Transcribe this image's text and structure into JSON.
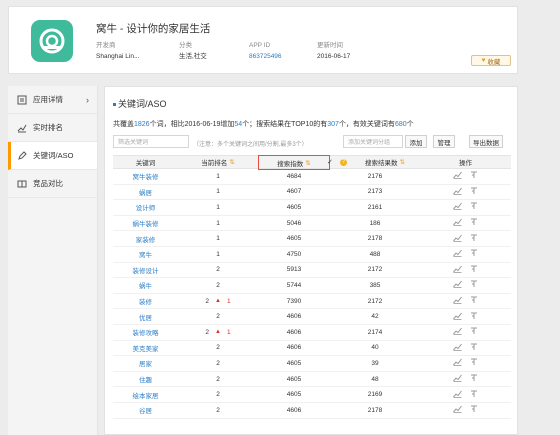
{
  "app": {
    "name": "窝牛 - 设计你的家居生活",
    "meta": [
      {
        "label": "开发商",
        "value": "Shanghai Lin..."
      },
      {
        "label": "分类",
        "value": "生活,社交"
      },
      {
        "label": "APP ID",
        "value": "863725496"
      },
      {
        "label": "更新时间",
        "value": "2016-06-17"
      }
    ],
    "favorite_label": "收藏"
  },
  "sidebar": {
    "items": [
      {
        "label": "应用详情",
        "icon": "app-detail-icon"
      },
      {
        "label": "实时排名",
        "icon": "ranking-chart-icon"
      },
      {
        "label": "关键词/ASO",
        "icon": "pen-icon"
      },
      {
        "label": "竞品对比",
        "icon": "compare-icon"
      }
    ]
  },
  "main": {
    "title": "关键词/ASO",
    "summary": {
      "p1": "共覆盖",
      "total": "1826",
      "p2": "个词，相比2016-06-19增加",
      "added": "54",
      "p3": "个；搜索结果在TOP10的有",
      "top10": "307",
      "p4": "个，有效关键词有",
      "valid": "680",
      "p5": "个"
    },
    "filter_placeholder": "筛选关键词",
    "hint": "（注意：多个关键词之间用/分割,最多3个）",
    "add_placeholder": "添加关键词分组",
    "add_label": "添加",
    "manage_label": "管理",
    "export_label": "导出数据"
  },
  "table": {
    "headers": [
      "关键词",
      "当前排名",
      "搜索指数",
      "搜索结果数",
      "操作"
    ],
    "rows": [
      {
        "keyword": "窝牛装修",
        "rank": "1",
        "change": "",
        "index": "4684",
        "results": "2176"
      },
      {
        "keyword": "蜗居",
        "rank": "1",
        "change": "",
        "index": "4607",
        "results": "2173"
      },
      {
        "keyword": "设计师",
        "rank": "1",
        "change": "",
        "index": "4605",
        "results": "2161"
      },
      {
        "keyword": "蜗牛装修",
        "rank": "1",
        "change": "",
        "index": "5046",
        "results": "186"
      },
      {
        "keyword": "家装修",
        "rank": "1",
        "change": "",
        "index": "4605",
        "results": "2178"
      },
      {
        "keyword": "窝牛",
        "rank": "1",
        "change": "",
        "index": "4750",
        "results": "488"
      },
      {
        "keyword": "装修设计",
        "rank": "2",
        "change": "",
        "index": "5913",
        "results": "2172"
      },
      {
        "keyword": "蜗牛",
        "rank": "2",
        "change": "",
        "index": "5744",
        "results": "385"
      },
      {
        "keyword": "装修",
        "rank": "2",
        "change": "1",
        "index": "7390",
        "results": "2172"
      },
      {
        "keyword": "优居",
        "rank": "2",
        "change": "",
        "index": "4606",
        "results": "42"
      },
      {
        "keyword": "装修攻略",
        "rank": "2",
        "change": "1",
        "index": "4606",
        "results": "2174"
      },
      {
        "keyword": "美克美家",
        "rank": "2",
        "change": "",
        "index": "4606",
        "results": "40"
      },
      {
        "keyword": "居家",
        "rank": "2",
        "change": "",
        "index": "4605",
        "results": "39"
      },
      {
        "keyword": "住趣",
        "rank": "2",
        "change": "",
        "index": "4605",
        "results": "48"
      },
      {
        "keyword": "绘本家居",
        "rank": "2",
        "change": "",
        "index": "4605",
        "results": "2169"
      },
      {
        "keyword": "谷居",
        "rank": "2",
        "change": "",
        "index": "4606",
        "results": "2178"
      }
    ]
  },
  "colors": {
    "accent": "#2a7dc7",
    "active_bar": "#ff9900",
    "up": "#e02b2b",
    "app_icon": "#3fba9b",
    "highlight_border": "#e74c3c"
  }
}
